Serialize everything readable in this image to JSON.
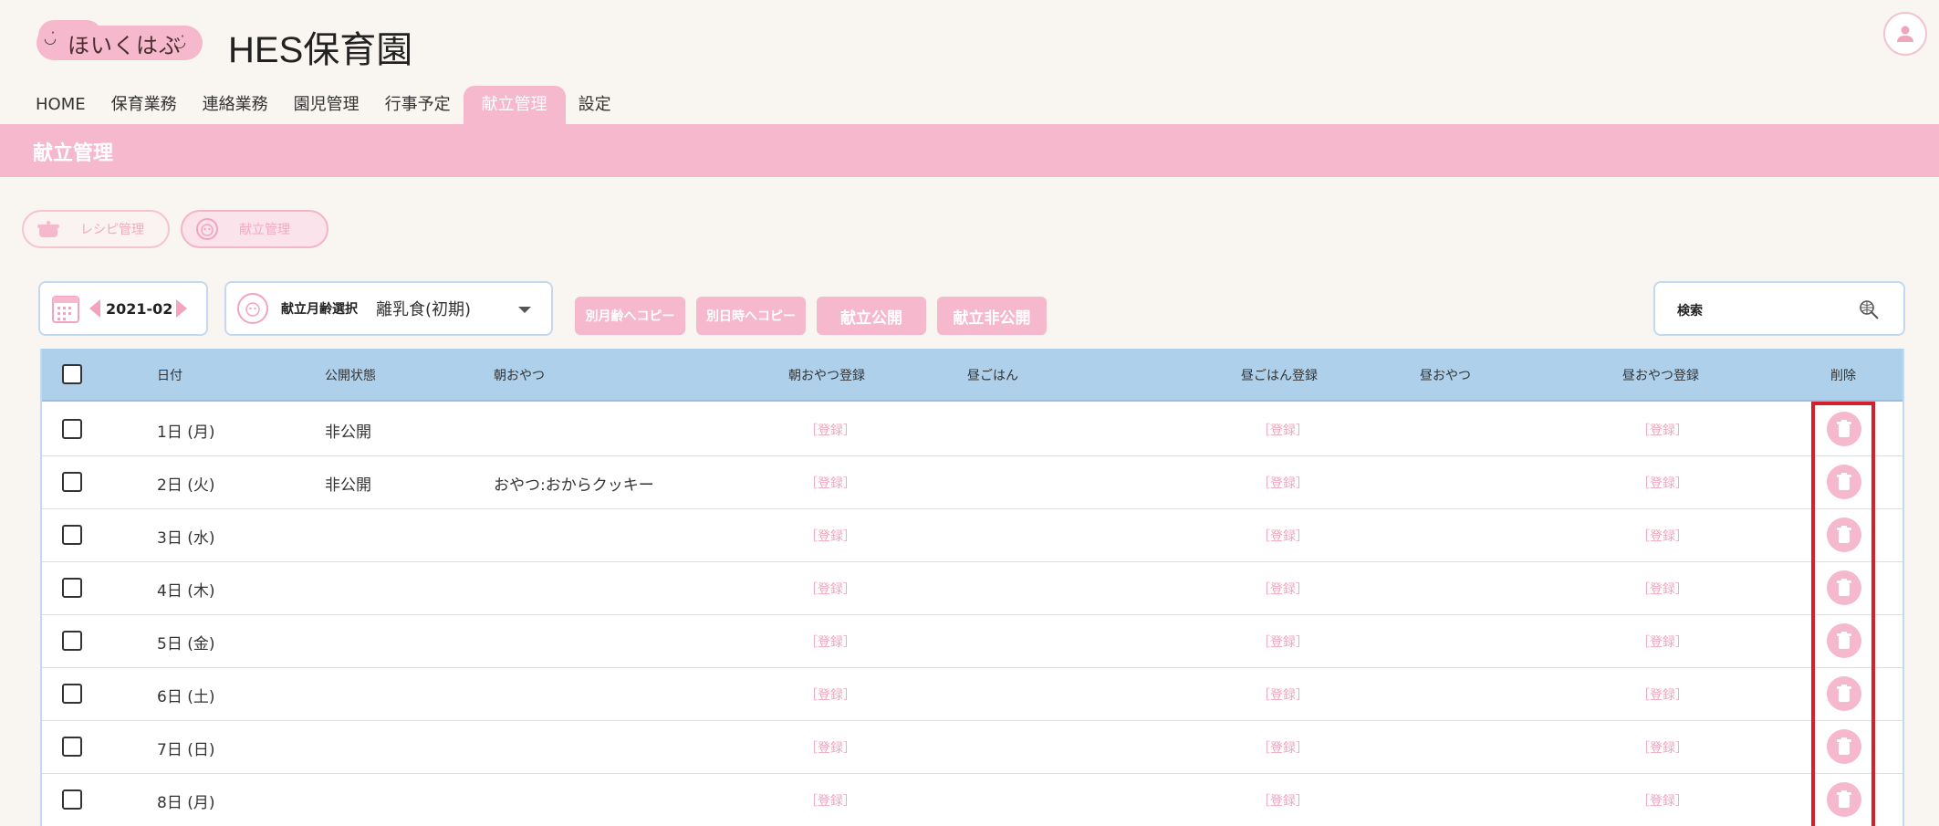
{
  "app": {
    "logo_text": "ほいくはぶ",
    "site_title": "HES保育園"
  },
  "nav": [
    {
      "label": "HOME",
      "active": false
    },
    {
      "label": "保育業務",
      "active": false
    },
    {
      "label": "連絡業務",
      "active": false
    },
    {
      "label": "園児管理",
      "active": false
    },
    {
      "label": "行事予定",
      "active": false
    },
    {
      "label": "献立管理",
      "active": true
    },
    {
      "label": "設定",
      "active": false
    }
  ],
  "banner": {
    "title": "献立管理"
  },
  "sub_tabs": [
    {
      "label": "レシピ管理",
      "icon": "pot-icon"
    },
    {
      "label": "献立管理",
      "icon": "menu-face-icon"
    }
  ],
  "controls": {
    "date": "2021-02",
    "age_label": "献立月齢選択",
    "age_value": "離乳食(初期)",
    "buttons": [
      "別月齢へコピー",
      "別日時へコピー",
      "献立公開",
      "献立非公開"
    ],
    "search_label": "検索"
  },
  "table": {
    "headers": [
      "日付",
      "公開状態",
      "朝おやつ",
      "朝おやつ登録",
      "昼ごはん",
      "昼ごはん登録",
      "昼おやつ",
      "昼おやつ登録",
      "削除"
    ],
    "register_label": "［登録］",
    "rows": [
      {
        "date": "1日 (月)",
        "status": "非公開",
        "morning_snack": "",
        "lunch": "",
        "afternoon_snack": ""
      },
      {
        "date": "2日 (火)",
        "status": "非公開",
        "morning_snack": "おやつ:おからクッキー",
        "lunch": "",
        "afternoon_snack": ""
      },
      {
        "date": "3日 (水)",
        "status": "",
        "morning_snack": "",
        "lunch": "",
        "afternoon_snack": ""
      },
      {
        "date": "4日 (木)",
        "status": "",
        "morning_snack": "",
        "lunch": "",
        "afternoon_snack": ""
      },
      {
        "date": "5日 (金)",
        "status": "",
        "morning_snack": "",
        "lunch": "",
        "afternoon_snack": ""
      },
      {
        "date": "6日 (土)",
        "status": "",
        "morning_snack": "",
        "lunch": "",
        "afternoon_snack": ""
      },
      {
        "date": "7日 (日)",
        "status": "",
        "morning_snack": "",
        "lunch": "",
        "afternoon_snack": ""
      },
      {
        "date": "8日 (月)",
        "status": "",
        "morning_snack": "",
        "lunch": "",
        "afternoon_snack": ""
      }
    ]
  },
  "colors": {
    "accent_pink": "#f5b8cc",
    "header_blue": "#aed0ea",
    "highlight_red": "#d61f2a"
  }
}
